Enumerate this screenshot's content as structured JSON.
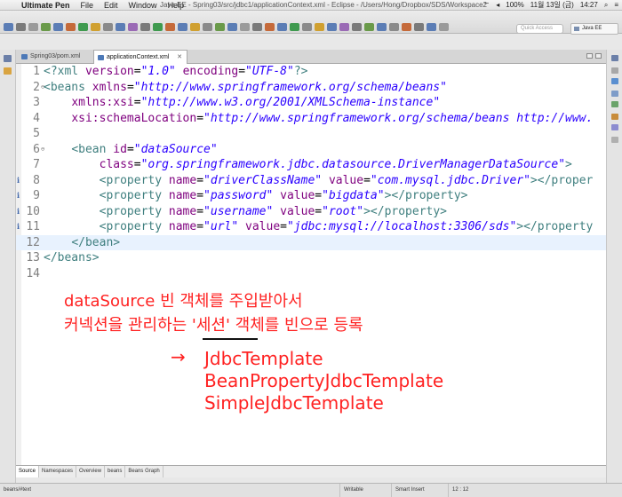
{
  "menubar": {
    "app": "Ultimate Pen",
    "menus": [
      "File",
      "Edit",
      "Window",
      "Help"
    ],
    "window_title": "Java EE - Spring03/src/jdbc1/applicationContext.xml - Eclipse - /Users/Hong/Dropbox/SDS/Workspace2",
    "battery": "100%",
    "date": "11월 13일 (금)",
    "time": "14:27"
  },
  "toolbar": {
    "quick_access_placeholder": "Quick Access",
    "perspective": "Java EE"
  },
  "editor_tabs": [
    {
      "label": "Spring03/pom.xml",
      "active": false
    },
    {
      "label": "applicationContext.xml",
      "active": true,
      "close": "✕"
    }
  ],
  "code_lines": [
    {
      "num": "1",
      "fold": "",
      "info": "",
      "cur": false,
      "segs": [
        [
          "tg",
          "<?xml "
        ],
        [
          "at",
          "version"
        ],
        [
          "pn",
          "="
        ],
        [
          "vl",
          "\"1.0\""
        ],
        [
          "pn",
          " "
        ],
        [
          "at",
          "encoding"
        ],
        [
          "pn",
          "="
        ],
        [
          "vl",
          "\"UTF-8\""
        ],
        [
          "tg",
          "?>"
        ]
      ]
    },
    {
      "num": "2",
      "fold": "⊖",
      "info": "",
      "cur": false,
      "segs": [
        [
          "tg",
          "<beans "
        ],
        [
          "at",
          "xmlns"
        ],
        [
          "pn",
          "="
        ],
        [
          "vl",
          "\"http://www.springframework.org/schema/beans\""
        ]
      ]
    },
    {
      "num": "3",
      "fold": "",
      "info": "",
      "cur": false,
      "segs": [
        [
          "pn",
          "    "
        ],
        [
          "at",
          "xmlns:xsi"
        ],
        [
          "pn",
          "="
        ],
        [
          "vl",
          "\"http://www.w3.org/2001/XMLSchema-instance\""
        ]
      ]
    },
    {
      "num": "4",
      "fold": "",
      "info": "",
      "cur": false,
      "segs": [
        [
          "pn",
          "    "
        ],
        [
          "at",
          "xsi:schemaLocation"
        ],
        [
          "pn",
          "="
        ],
        [
          "vl",
          "\"http://www.springframework.org/schema/beans http://www."
        ]
      ]
    },
    {
      "num": "5",
      "fold": "",
      "info": "",
      "cur": false,
      "segs": []
    },
    {
      "num": "6",
      "fold": "⊖",
      "info": "",
      "cur": false,
      "segs": [
        [
          "pn",
          "    "
        ],
        [
          "tg",
          "<bean "
        ],
        [
          "at",
          "id"
        ],
        [
          "pn",
          "="
        ],
        [
          "vl",
          "\"dataSource\""
        ]
      ]
    },
    {
      "num": "7",
      "fold": "",
      "info": "",
      "cur": false,
      "segs": [
        [
          "pn",
          "        "
        ],
        [
          "at",
          "class"
        ],
        [
          "pn",
          "="
        ],
        [
          "vl",
          "\"org.springframework.jdbc.datasource.DriverManagerDataSource\""
        ],
        [
          "tg",
          ">"
        ]
      ]
    },
    {
      "num": "8",
      "fold": "",
      "info": "i",
      "cur": false,
      "segs": [
        [
          "pn",
          "        "
        ],
        [
          "tg",
          "<property "
        ],
        [
          "at",
          "name"
        ],
        [
          "pn",
          "="
        ],
        [
          "vl",
          "\"driverClassName\""
        ],
        [
          "pn",
          " "
        ],
        [
          "at",
          "value"
        ],
        [
          "pn",
          "="
        ],
        [
          "vl",
          "\"com.mysql.jdbc.Driver\""
        ],
        [
          "tg",
          "></proper"
        ]
      ]
    },
    {
      "num": "9",
      "fold": "",
      "info": "i",
      "cur": false,
      "segs": [
        [
          "pn",
          "        "
        ],
        [
          "tg",
          "<property "
        ],
        [
          "at",
          "name"
        ],
        [
          "pn",
          "="
        ],
        [
          "vl",
          "\"password\""
        ],
        [
          "pn",
          " "
        ],
        [
          "at",
          "value"
        ],
        [
          "pn",
          "="
        ],
        [
          "vl",
          "\"bigdata\""
        ],
        [
          "tg",
          "></property>"
        ]
      ]
    },
    {
      "num": "10",
      "fold": "",
      "info": "i",
      "cur": false,
      "segs": [
        [
          "pn",
          "        "
        ],
        [
          "tg",
          "<property "
        ],
        [
          "at",
          "name"
        ],
        [
          "pn",
          "="
        ],
        [
          "vl",
          "\"username\""
        ],
        [
          "pn",
          " "
        ],
        [
          "at",
          "value"
        ],
        [
          "pn",
          "="
        ],
        [
          "vl",
          "\"root\""
        ],
        [
          "tg",
          "></property>"
        ]
      ]
    },
    {
      "num": "11",
      "fold": "",
      "info": "i",
      "cur": false,
      "segs": [
        [
          "pn",
          "        "
        ],
        [
          "tg",
          "<property "
        ],
        [
          "at",
          "name"
        ],
        [
          "pn",
          "="
        ],
        [
          "vl",
          "\"url\""
        ],
        [
          "pn",
          " "
        ],
        [
          "at",
          "value"
        ],
        [
          "pn",
          "="
        ],
        [
          "vl",
          "\"jdbc:mysql://localhost:3306/sds\""
        ],
        [
          "tg",
          "></property"
        ]
      ]
    },
    {
      "num": "12",
      "fold": "",
      "info": "",
      "cur": true,
      "segs": [
        [
          "pn",
          "    "
        ],
        [
          "tg",
          "</bean>"
        ]
      ]
    },
    {
      "num": "13",
      "fold": "",
      "info": "",
      "cur": false,
      "segs": [
        [
          "tg",
          "</beans>"
        ]
      ]
    },
    {
      "num": "14",
      "fold": "",
      "info": "",
      "cur": false,
      "segs": []
    }
  ],
  "annotation": {
    "line1": "dataSource 빈 객체를 주입받아서",
    "line2": "커넥션을 관리하는 '세션' 객체를 빈으로 등록",
    "arrow": "→",
    "items": [
      "JdbcTemplate",
      "BeanPropertyJdbcTemplate",
      "SimpleJdbcTemplate"
    ],
    "color": "#ff2222"
  },
  "bottom_tabs": [
    "Source",
    "Namespaces",
    "Overview",
    "beans",
    "Beans Graph"
  ],
  "statusbar": {
    "path": "beans/#text",
    "mode": "Writable",
    "insert": "Smart Insert",
    "position": "12 : 12"
  }
}
